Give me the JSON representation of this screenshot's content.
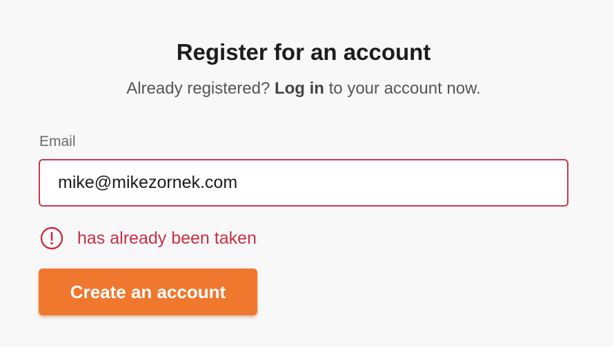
{
  "header": {
    "title": "Register for an account",
    "subtitle_prefix": "Already registered? ",
    "login_link": "Log in",
    "subtitle_suffix": " to your account now."
  },
  "form": {
    "email_label": "Email",
    "email_value": "mike@mikezornek.com",
    "email_error": "has already been taken",
    "submit_label": "Create an account"
  },
  "colors": {
    "accent": "#ef772e",
    "error": "#cc2d45",
    "error_border": "#d0344f",
    "background": "#f8f8f8"
  },
  "icons": {
    "error": "exclamation-circle-icon"
  }
}
